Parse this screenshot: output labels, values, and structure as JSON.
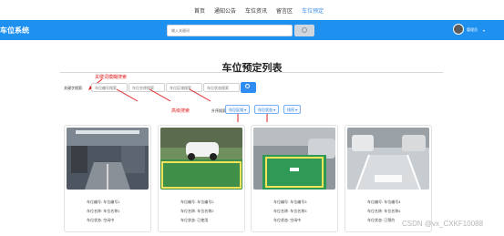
{
  "topnav": {
    "items": [
      {
        "label": "首页",
        "active": false
      },
      {
        "label": "通知公告",
        "active": false
      },
      {
        "label": "车位资讯",
        "active": false
      },
      {
        "label": "留言区",
        "active": false
      },
      {
        "label": "车位预定",
        "active": true
      }
    ]
  },
  "header": {
    "brand": "车位系统",
    "search_placeholder": "输入关键词",
    "user_name": "管理员"
  },
  "page": {
    "title": "车位预定列表"
  },
  "annotations": {
    "keyword_search": "关键词模糊搜索",
    "advanced_search": "高级搜索"
  },
  "filters": {
    "label": "关键字搜索:",
    "inputs": [
      "车位编号搜索",
      "车位名称搜索",
      "车位区域搜索",
      "车位状态搜索"
    ]
  },
  "sort": {
    "label": "升序搜索:",
    "buttons": [
      "车位区域 ▾",
      "车位状态 ▾",
      "排序 ▾"
    ]
  },
  "cards": [
    {
      "no": "车位编号: 车位编号1",
      "name": "车位名称: 车位名称1",
      "status": "车位状态: 空闲中"
    },
    {
      "no": "车位编号: 车位编号2",
      "name": "车位名称: 车位名称2",
      "status": "车位状态: 已使用"
    },
    {
      "no": "车位编号: 车位编号3",
      "name": "车位名称: 车位名称3",
      "status": "车位状态: 空闲中"
    },
    {
      "no": "车位编号: 车位编号4",
      "name": "车位名称: 车位名称4",
      "status": "车位状态: 已预约"
    }
  ],
  "watermark": "CSDN @vx_CXKF10088"
}
